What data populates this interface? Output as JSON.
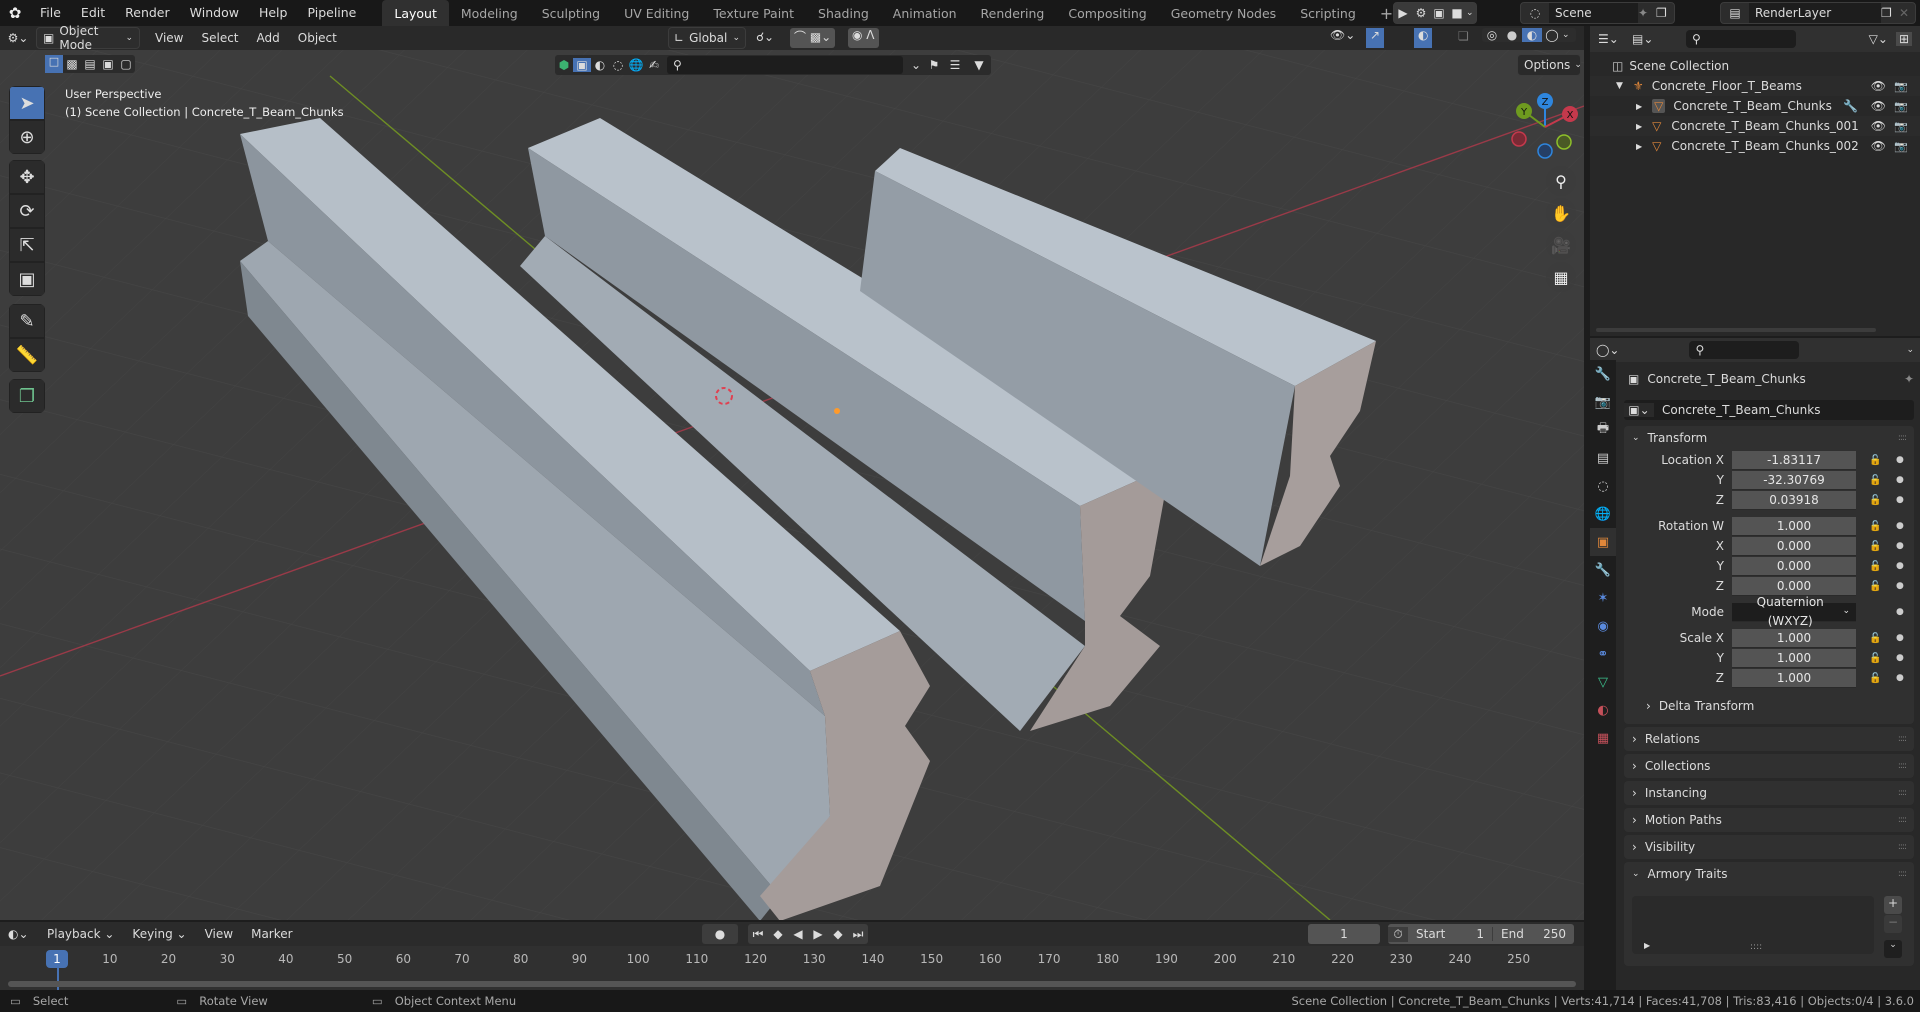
{
  "topbar": {
    "menus": [
      "File",
      "Edit",
      "Render",
      "Window",
      "Help",
      "Pipeline"
    ],
    "workspaces": [
      "Layout",
      "Modeling",
      "Sculpting",
      "UV Editing",
      "Texture Paint",
      "Shading",
      "Animation",
      "Rendering",
      "Compositing",
      "Geometry Nodes",
      "Scripting"
    ],
    "active_workspace": "Layout",
    "add_workspace": "+",
    "scene": "Scene",
    "view_layer": "RenderLayer"
  },
  "viewport_header": {
    "mode": "Object Mode",
    "menus": [
      "View",
      "Select",
      "Add",
      "Object"
    ],
    "orientation": "Global",
    "options_label": "Options"
  },
  "viewport": {
    "view_name": "User Perspective",
    "view_info": "(1) Scene Collection | Concrete_T_Beam_Chunks",
    "gizmo_axes": [
      "X",
      "Y",
      "Z"
    ]
  },
  "outliner": {
    "search_placeholder": "",
    "root": "Scene Collection",
    "collection": "Concrete_Floor_T_Beams",
    "items": [
      {
        "name": "Concrete_T_Beam_Chunks",
        "active": true,
        "modifier": true
      },
      {
        "name": "Concrete_T_Beam_Chunks_001",
        "active": false,
        "modifier": false
      },
      {
        "name": "Concrete_T_Beam_Chunks_002",
        "active": false,
        "modifier": false
      }
    ]
  },
  "properties": {
    "object_name": "Concrete_T_Beam_Chunks",
    "object_field": "Concrete_T_Beam_Chunks",
    "transform_title": "Transform",
    "location": {
      "label": "Location X",
      "x": "-1.83117",
      "y": "-32.30769",
      "z": "0.03918"
    },
    "rotation": {
      "label": "Rotation W",
      "w": "1.000",
      "x": "0.000",
      "y": "0.000",
      "z": "0.000"
    },
    "mode_label": "Mode",
    "mode_value": "Quaternion (WXYZ)",
    "scale": {
      "label": "Scale X",
      "x": "1.000",
      "y": "1.000",
      "z": "1.000"
    },
    "axis_labels": {
      "x": "X",
      "y": "Y",
      "z": "Z"
    },
    "delta_transform": "Delta Transform",
    "panels": [
      "Relations",
      "Collections",
      "Instancing",
      "Motion Paths",
      "Visibility"
    ],
    "armory_traits": "Armory Traits"
  },
  "timeline": {
    "menus": [
      "Playback",
      "Keying",
      "View",
      "Marker"
    ],
    "current_frame": "1",
    "start_label": "Start",
    "start": "1",
    "end_label": "End",
    "end": "250",
    "ticks": [
      "10",
      "20",
      "30",
      "40",
      "50",
      "60",
      "70",
      "80",
      "90",
      "100",
      "110",
      "120",
      "130",
      "140",
      "150",
      "160",
      "170",
      "180",
      "190",
      "200",
      "210",
      "220",
      "230",
      "240",
      "250"
    ],
    "playhead": "1"
  },
  "statusbar": {
    "select": "Select",
    "rotate": "Rotate View",
    "context": "Object Context Menu",
    "stats": "Scene Collection | Concrete_T_Beam_Chunks | Verts:41,714 | Faces:41,708 | Tris:83,416 | Objects:0/4 | 3.6.0"
  },
  "colors": {
    "accent": "#4772b3",
    "object_orange": "#e0873a",
    "x_axis": "#c5394c",
    "y_axis": "#6e9a1f",
    "z_axis": "#2e86de"
  }
}
